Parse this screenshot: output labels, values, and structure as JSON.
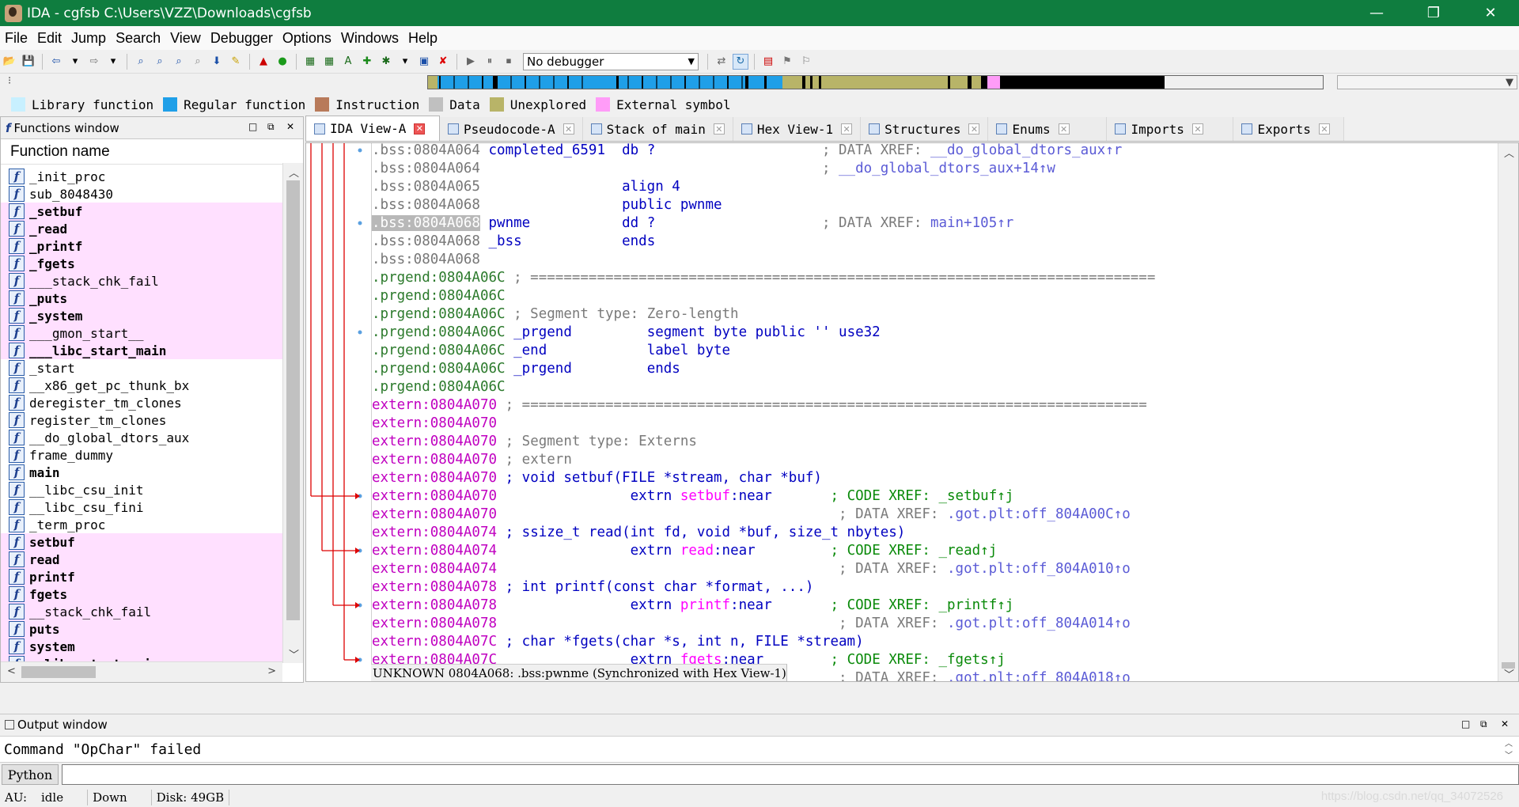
{
  "window": {
    "title": "IDA - cgfsb C:\\Users\\VZZ\\Downloads\\cgfsb",
    "minimize": "—",
    "restore": "❐",
    "close": "✕"
  },
  "menu": [
    "File",
    "Edit",
    "Jump",
    "Search",
    "View",
    "Debugger",
    "Options",
    "Windows",
    "Help"
  ],
  "toolbar": {
    "debugger_select": "No debugger"
  },
  "legend": [
    {
      "label": "Library function",
      "color": "#c8f0ff"
    },
    {
      "label": "Regular function",
      "color": "#1f9fe8"
    },
    {
      "label": "Instruction",
      "color": "#b87a5a"
    },
    {
      "label": "Data",
      "color": "#c0c0c0"
    },
    {
      "label": "Unexplored",
      "color": "#b8b468"
    },
    {
      "label": "External symbol",
      "color": "#ff9cf8"
    }
  ],
  "navbar_colors": [
    "#1f9fe8",
    "#000000",
    "#1f9fe8",
    "#b8b468",
    "#000000",
    "#ff9cf8",
    "#000000"
  ],
  "functions_window": {
    "title": "Functions window",
    "column": "Function name",
    "items": [
      {
        "name": "_init_proc",
        "lib": false,
        "bold": false
      },
      {
        "name": "sub_8048430",
        "lib": false,
        "bold": false
      },
      {
        "name": "_setbuf",
        "lib": true,
        "bold": true
      },
      {
        "name": "_read",
        "lib": true,
        "bold": true
      },
      {
        "name": "_printf",
        "lib": true,
        "bold": true
      },
      {
        "name": "_fgets",
        "lib": true,
        "bold": true
      },
      {
        "name": "___stack_chk_fail",
        "lib": true,
        "bold": false
      },
      {
        "name": "_puts",
        "lib": true,
        "bold": true
      },
      {
        "name": "_system",
        "lib": true,
        "bold": true
      },
      {
        "name": "___gmon_start__",
        "lib": true,
        "bold": false
      },
      {
        "name": "___libc_start_main",
        "lib": true,
        "bold": true
      },
      {
        "name": "_start",
        "lib": false,
        "bold": false
      },
      {
        "name": "__x86_get_pc_thunk_bx",
        "lib": false,
        "bold": false
      },
      {
        "name": "deregister_tm_clones",
        "lib": false,
        "bold": false
      },
      {
        "name": "register_tm_clones",
        "lib": false,
        "bold": false
      },
      {
        "name": "__do_global_dtors_aux",
        "lib": false,
        "bold": false
      },
      {
        "name": "frame_dummy",
        "lib": false,
        "bold": false
      },
      {
        "name": "main",
        "lib": false,
        "bold": true
      },
      {
        "name": "__libc_csu_init",
        "lib": false,
        "bold": false
      },
      {
        "name": "__libc_csu_fini",
        "lib": false,
        "bold": false
      },
      {
        "name": "_term_proc",
        "lib": false,
        "bold": false
      },
      {
        "name": "setbuf",
        "lib": true,
        "bold": true
      },
      {
        "name": "read",
        "lib": true,
        "bold": true
      },
      {
        "name": "printf",
        "lib": true,
        "bold": true
      },
      {
        "name": "fgets",
        "lib": true,
        "bold": true
      },
      {
        "name": "__stack_chk_fail",
        "lib": true,
        "bold": false
      },
      {
        "name": "puts",
        "lib": true,
        "bold": true
      },
      {
        "name": "system",
        "lib": true,
        "bold": true
      },
      {
        "name": "__libc_start_main",
        "lib": true,
        "bold": true
      }
    ]
  },
  "tabs": [
    {
      "label": "IDA View-A",
      "active": true
    },
    {
      "label": "Pseudocode-A",
      "active": false
    },
    {
      "label": "Stack of main",
      "active": false
    },
    {
      "label": "Hex View-1",
      "active": false
    },
    {
      "label": "Structures",
      "active": false
    },
    {
      "label": "Enums",
      "active": false
    },
    {
      "label": "Imports",
      "active": false
    },
    {
      "label": "Exports",
      "active": false
    }
  ],
  "disasm": {
    "lines": [
      {
        "addr": ".bss:0804A064",
        "k": "bss",
        "dot": true,
        "rest": [
          [
            "lbl",
            " completed_6591  "
          ],
          [
            "ins",
            "db ?"
          ],
          [
            "cmt",
            "                    ; DATA XREF: "
          ],
          [
            "xr",
            "__do_global_dtors_aux↑r"
          ]
        ]
      },
      {
        "addr": ".bss:0804A064",
        "k": "bss",
        "dot": false,
        "rest": [
          [
            "cmt",
            "                                         ; "
          ],
          [
            "xr",
            "__do_global_dtors_aux+14↑w"
          ]
        ]
      },
      {
        "addr": ".bss:0804A065",
        "k": "bss",
        "dot": false,
        "rest": [
          [
            "ins",
            "                 align 4"
          ]
        ]
      },
      {
        "addr": ".bss:0804A068",
        "k": "bss",
        "dot": false,
        "rest": [
          [
            "ins",
            "                 public pwnme"
          ]
        ]
      },
      {
        "addr": ".bss:0804A068",
        "k": "sel",
        "dot": true,
        "rest": [
          [
            "lbl",
            " pwnme           "
          ],
          [
            "ins",
            "dd ?"
          ],
          [
            "cmt",
            "                    ; DATA XREF: "
          ],
          [
            "xr",
            "main+105↑r"
          ]
        ]
      },
      {
        "addr": ".bss:0804A068",
        "k": "bss",
        "dot": false,
        "rest": [
          [
            "lbl",
            " _bss            "
          ],
          [
            "ins",
            "ends"
          ]
        ]
      },
      {
        "addr": ".bss:0804A068",
        "k": "bss",
        "dot": false,
        "rest": []
      },
      {
        "addr": ".prgend:0804A06C",
        "k": "pg",
        "dot": false,
        "rest": [
          [
            "cmt",
            " ; ==========================================================================="
          ]
        ]
      },
      {
        "addr": ".prgend:0804A06C",
        "k": "pg",
        "dot": false,
        "rest": []
      },
      {
        "addr": ".prgend:0804A06C",
        "k": "pg",
        "dot": false,
        "rest": [
          [
            "cmt",
            " ; Segment type: Zero-length"
          ]
        ]
      },
      {
        "addr": ".prgend:0804A06C",
        "k": "pg",
        "dot": true,
        "rest": [
          [
            "lbl",
            " _prgend         "
          ],
          [
            "ins",
            "segment byte public '' use32"
          ]
        ]
      },
      {
        "addr": ".prgend:0804A06C",
        "k": "pg",
        "dot": false,
        "rest": [
          [
            "lbl",
            " _end            "
          ],
          [
            "ins",
            "label byte"
          ]
        ]
      },
      {
        "addr": ".prgend:0804A06C",
        "k": "pg",
        "dot": false,
        "rest": [
          [
            "lbl",
            " _prgend         "
          ],
          [
            "ins",
            "ends"
          ]
        ]
      },
      {
        "addr": ".prgend:0804A06C",
        "k": "pg",
        "dot": false,
        "rest": []
      },
      {
        "addr": "extern:0804A070",
        "k": "ex",
        "dot": false,
        "rest": [
          [
            "cmt",
            " ; ==========================================================================="
          ]
        ]
      },
      {
        "addr": "extern:0804A070",
        "k": "ex",
        "dot": false,
        "rest": []
      },
      {
        "addr": "extern:0804A070",
        "k": "ex",
        "dot": false,
        "rest": [
          [
            "cmt",
            " ; Segment type: Externs"
          ]
        ]
      },
      {
        "addr": "extern:0804A070",
        "k": "ex",
        "dot": false,
        "rest": [
          [
            "cmt",
            " ; extern"
          ]
        ]
      },
      {
        "addr": "extern:0804A070",
        "k": "ex",
        "dot": false,
        "rest": [
          [
            "pro",
            " ; void setbuf(FILE *stream, char *buf)"
          ]
        ]
      },
      {
        "addr": "extern:0804A070",
        "k": "ex",
        "dot": true,
        "rest": [
          [
            "ins",
            "                extrn "
          ],
          [
            "pn",
            "setbuf"
          ],
          [
            "ins",
            ":near"
          ],
          [
            "cmt",
            "       "
          ],
          [
            "xg",
            "; CODE XREF: _setbuf↑j"
          ]
        ]
      },
      {
        "addr": "extern:0804A070",
        "k": "ex",
        "dot": false,
        "rest": [
          [
            "cmt",
            "                                         ; DATA XREF: "
          ],
          [
            "xr",
            ".got.plt:off_804A00C↑o"
          ]
        ]
      },
      {
        "addr": "extern:0804A074",
        "k": "ex",
        "dot": false,
        "rest": [
          [
            "pro",
            " ; ssize_t read(int fd, void *buf, size_t nbytes)"
          ]
        ]
      },
      {
        "addr": "extern:0804A074",
        "k": "ex",
        "dot": true,
        "rest": [
          [
            "ins",
            "                extrn "
          ],
          [
            "pn",
            "read"
          ],
          [
            "ins",
            ":near"
          ],
          [
            "cmt",
            "         "
          ],
          [
            "xg",
            "; CODE XREF: _read↑j"
          ]
        ]
      },
      {
        "addr": "extern:0804A074",
        "k": "ex",
        "dot": false,
        "rest": [
          [
            "cmt",
            "                                         ; DATA XREF: "
          ],
          [
            "xr",
            ".got.plt:off_804A010↑o"
          ]
        ]
      },
      {
        "addr": "extern:0804A078",
        "k": "ex",
        "dot": false,
        "rest": [
          [
            "pro",
            " ; int printf(const char *format, ...)"
          ]
        ]
      },
      {
        "addr": "extern:0804A078",
        "k": "ex",
        "dot": true,
        "rest": [
          [
            "ins",
            "                extrn "
          ],
          [
            "pn",
            "printf"
          ],
          [
            "ins",
            ":near"
          ],
          [
            "cmt",
            "       "
          ],
          [
            "xg",
            "; CODE XREF: _printf↑j"
          ]
        ]
      },
      {
        "addr": "extern:0804A078",
        "k": "ex",
        "dot": false,
        "rest": [
          [
            "cmt",
            "                                         ; DATA XREF: "
          ],
          [
            "xr",
            ".got.plt:off_804A014↑o"
          ]
        ]
      },
      {
        "addr": "extern:0804A07C",
        "k": "ex",
        "dot": false,
        "rest": [
          [
            "pro",
            " ; char *fgets(char *s, int n, FILE *stream)"
          ]
        ]
      },
      {
        "addr": "extern:0804A07C",
        "k": "ex",
        "dot": true,
        "rest": [
          [
            "ins",
            "                extrn "
          ],
          [
            "pn",
            "fgets"
          ],
          [
            "ins",
            ":near"
          ],
          [
            "cmt",
            "        "
          ],
          [
            "xg",
            "; CODE XREF: _fgets↑j"
          ]
        ]
      },
      {
        "addr": "extern:0804A07C",
        "k": "ex",
        "dot": false,
        "rest": [
          [
            "cmt",
            "                                         ; DATA XREF: "
          ],
          [
            "xr",
            ".got.plt:off_804A018↑o"
          ]
        ]
      }
    ],
    "status_line": "UNKNOWN 0804A068: .bss:pwnme (Synchronized with Hex View-1)"
  },
  "output": {
    "title": "Output window",
    "text": "Command \"OpChar\" failed"
  },
  "python_button": "Python",
  "status": {
    "au": "AU:",
    "state": "idle",
    "direction": "Down",
    "disk": "Disk: 49GB"
  },
  "watermark": "https://blog.csdn.net/qq_34072526"
}
